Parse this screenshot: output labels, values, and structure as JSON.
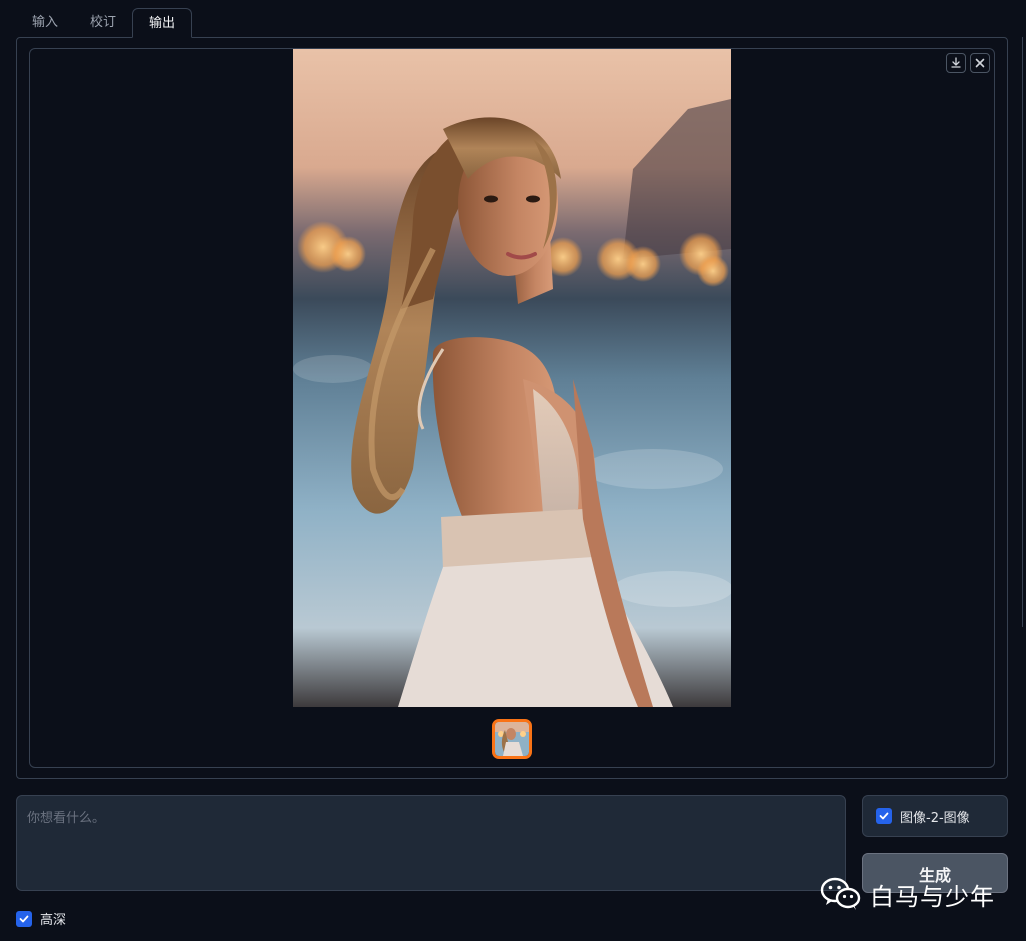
{
  "tabs": [
    {
      "label": "输入"
    },
    {
      "label": "校订"
    },
    {
      "label": "输出",
      "active": true
    }
  ],
  "gallery": {
    "download_icon": "download-icon",
    "close_icon": "close-icon",
    "main_image": "portrait-woman-beach-sunset",
    "thumbnail_count": 1
  },
  "prompt": {
    "placeholder": "你想看什么。",
    "value": ""
  },
  "mode": {
    "label": "图像-2-图像",
    "checked": true
  },
  "generate_button": {
    "label": "生成"
  },
  "hd_option": {
    "label": "高深",
    "checked": true
  },
  "watermark": {
    "text": "白马与少年",
    "icon": "wechat-icon"
  },
  "colors": {
    "background": "#0b0f19",
    "border": "#374151",
    "accent_checkbox": "#2563eb",
    "thumbnail_border": "#f97316",
    "button_bg": "#4b5563"
  }
}
